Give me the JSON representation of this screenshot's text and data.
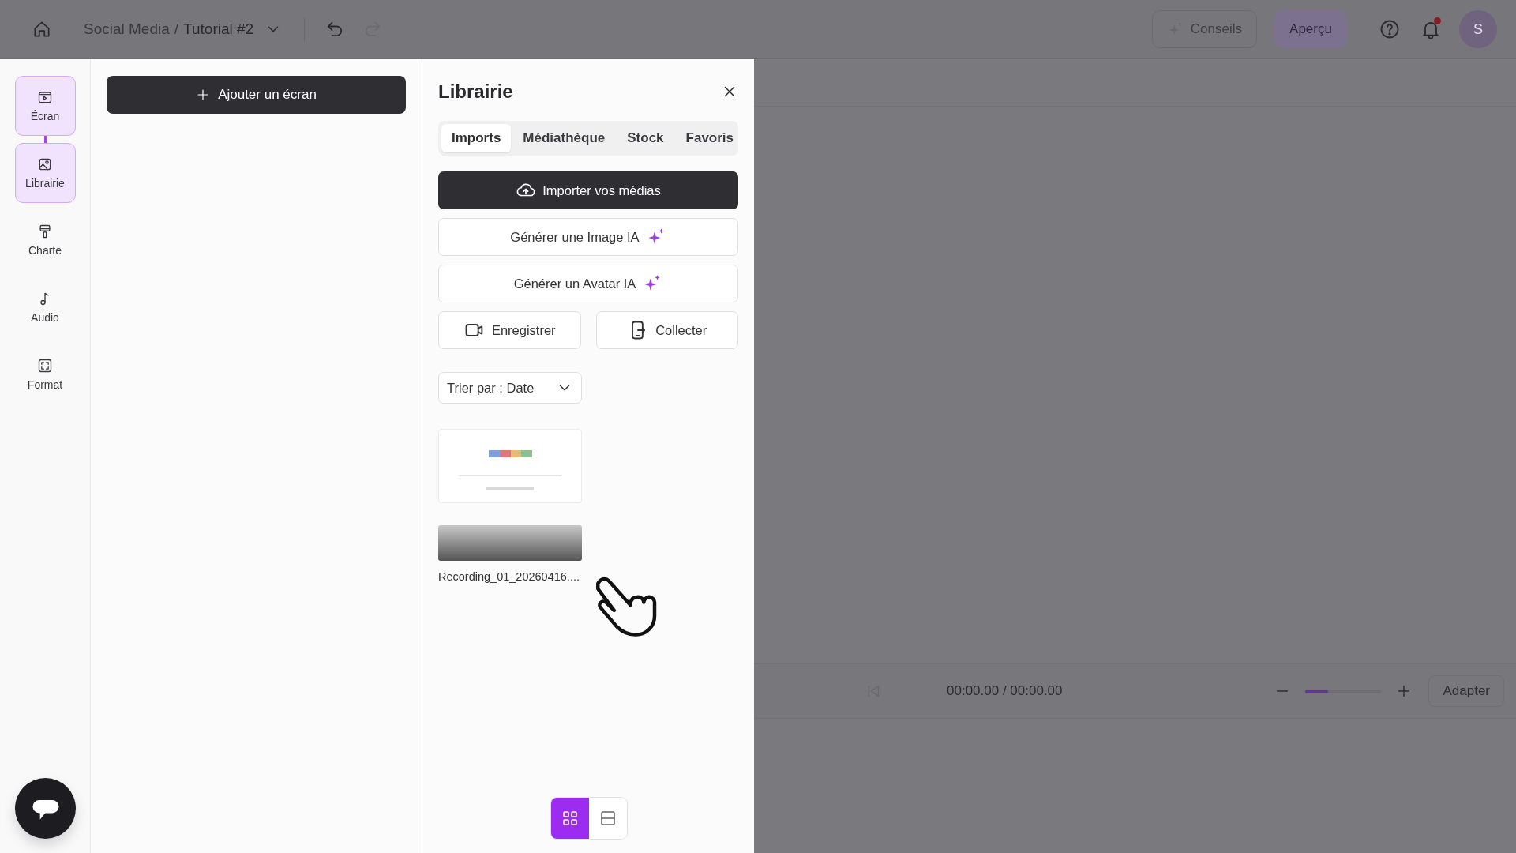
{
  "header": {
    "project": "Social Media",
    "separator": "/",
    "screen": "Tutorial #2",
    "tips_button": "Conseils",
    "preview_button": "Aperçu",
    "notifications_unread": true,
    "avatar": "S"
  },
  "sidebar": {
    "items": [
      {
        "label": "Écran",
        "kind": "screen",
        "selected": true
      },
      {
        "label": "Librairie",
        "kind": "library",
        "selected": true
      },
      {
        "label": "Charte",
        "kind": "brand",
        "selected": false
      },
      {
        "label": "Audio",
        "kind": "audio",
        "selected": false
      },
      {
        "label": "Format",
        "kind": "format",
        "selected": false
      }
    ]
  },
  "screens": {
    "add_button": "Ajouter un écran"
  },
  "library": {
    "title": "Librairie",
    "tabs": [
      {
        "label": "Imports",
        "selected": true
      },
      {
        "label": "Médiathèque",
        "selected": false
      },
      {
        "label": "Stock",
        "selected": false
      },
      {
        "label": "Favoris",
        "selected": false
      }
    ],
    "import_button": "Importer vos médias",
    "ai_buttons": [
      "Générer une Image IA",
      "Générer un Avatar IA"
    ],
    "record_button": "Enregistrer",
    "collect_button": "Collecter",
    "sort": "Trier par : Date",
    "media": [
      {
        "kind": "image"
      },
      {
        "kind": "video",
        "name": "Recording_01_20260416...."
      }
    ],
    "views": [
      {
        "kind": "grid",
        "selected": true
      },
      {
        "kind": "rows",
        "selected": false
      }
    ]
  },
  "timeline": {
    "time": "00:00.00 / 00:00.00",
    "zoom": {
      "level": 0.3
    },
    "fit_button": "Adapter"
  }
}
